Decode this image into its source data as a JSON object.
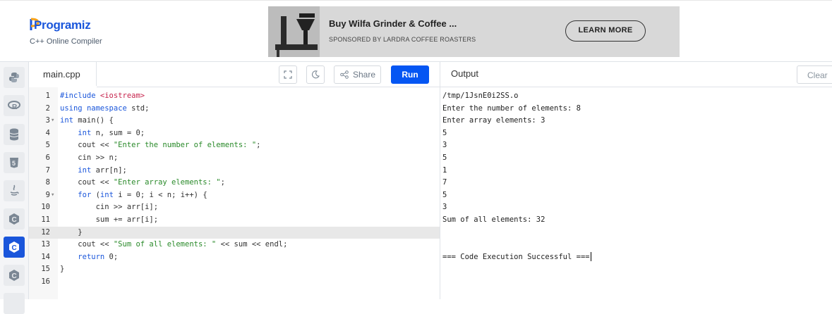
{
  "header": {
    "logo_text": "Programiz",
    "subtitle": "C++ Online Compiler"
  },
  "ad": {
    "title": "Buy Wilfa Grinder & Coffee ...",
    "sponsor": "SPONSORED BY LARDRA COFFEE ROASTERS",
    "cta": "LEARN MORE"
  },
  "sidebar": {
    "items": [
      {
        "icon": "python-icon"
      },
      {
        "icon": "r-icon"
      },
      {
        "icon": "database-icon"
      },
      {
        "icon": "html5-icon"
      },
      {
        "icon": "java-icon"
      },
      {
        "icon": "c-icon"
      },
      {
        "icon": "cpp-icon",
        "active": true
      },
      {
        "icon": "csharp-icon"
      }
    ]
  },
  "editor": {
    "filename": "main.cpp",
    "share_label": "Share",
    "run_label": "Run",
    "lines": [
      {
        "n": "1",
        "fold": "",
        "text": "#include <iostream>"
      },
      {
        "n": "2",
        "fold": "",
        "text": "using namespace std;"
      },
      {
        "n": "3",
        "fold": "▾",
        "text": "int main() {"
      },
      {
        "n": "4",
        "fold": "",
        "text": "    int n, sum = 0;"
      },
      {
        "n": "5",
        "fold": "",
        "text": "    cout << \"Enter the number of elements: \";"
      },
      {
        "n": "6",
        "fold": "",
        "text": "    cin >> n;"
      },
      {
        "n": "7",
        "fold": "",
        "text": "    int arr[n];"
      },
      {
        "n": "8",
        "fold": "",
        "text": "    cout << \"Enter array elements: \";"
      },
      {
        "n": "9",
        "fold": "▾",
        "text": "    for (int i = 0; i < n; i++) {"
      },
      {
        "n": "10",
        "fold": "",
        "text": "        cin >> arr[i];"
      },
      {
        "n": "11",
        "fold": "",
        "text": "        sum += arr[i];"
      },
      {
        "n": "12",
        "fold": "",
        "text": "    }",
        "highlight": true
      },
      {
        "n": "13",
        "fold": "",
        "text": "    cout << \"Sum of all elements: \" << sum << endl;"
      },
      {
        "n": "14",
        "fold": "",
        "text": "    return 0;"
      },
      {
        "n": "15",
        "fold": "",
        "text": "}"
      },
      {
        "n": "16",
        "fold": "",
        "text": ""
      }
    ]
  },
  "output": {
    "title": "Output",
    "clear_label": "Clear",
    "lines": [
      "/tmp/1JsnE0i2SS.o",
      "Enter the number of elements: 8",
      "Enter array elements: 3",
      "5",
      "3",
      "5",
      "1",
      "7",
      "5",
      "3",
      "Sum of all elements: 32",
      "",
      "",
      "=== Code Execution Successful ==="
    ]
  },
  "colors": {
    "brand_blue": "#1a56db",
    "run_blue": "#0556f3",
    "keyword": "#1a56db",
    "string": "#2a8a2a",
    "include": "#c7254e"
  }
}
